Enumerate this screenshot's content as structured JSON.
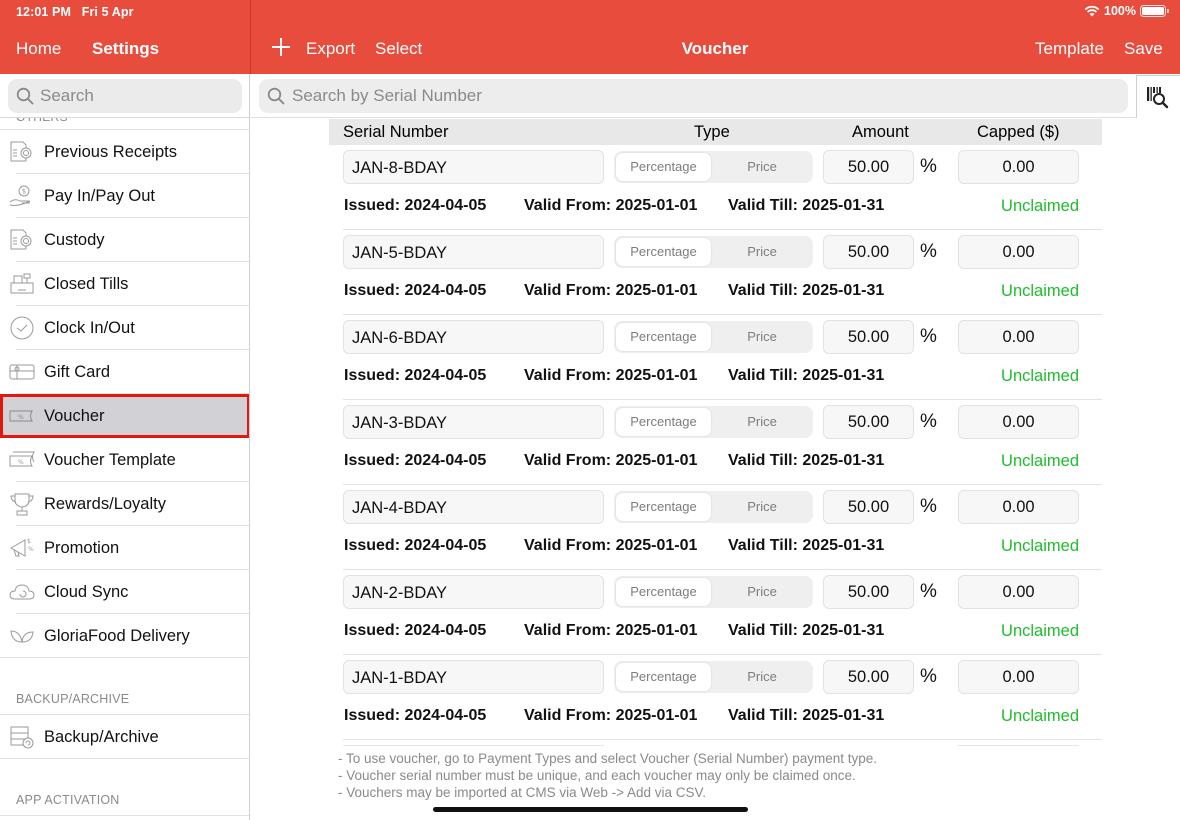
{
  "status_bar": {
    "time": "12:01 PM",
    "date": "Fri 5 Apr",
    "battery": "100%",
    "battery_level_percent": 100
  },
  "nav": {
    "home_label": "Home",
    "settings_label": "Settings",
    "add_icon": "plus-icon",
    "export_label": "Export",
    "select_label": "Select",
    "title": "Voucher",
    "template_label": "Template",
    "save_label": "Save"
  },
  "sidebar": {
    "search_placeholder": "Search",
    "cut_section_header": "OTHERS",
    "items": [
      {
        "label": "Previous Receipts",
        "icon": "receipt-icon"
      },
      {
        "label": "Pay In/Pay Out",
        "icon": "cash-hand-icon"
      },
      {
        "label": "Custody",
        "icon": "custody-icon"
      },
      {
        "label": "Closed Tills",
        "icon": "cash-register-icon"
      },
      {
        "label": "Clock In/Out",
        "icon": "clock-icon"
      },
      {
        "label": "Gift Card",
        "icon": "gift-card-icon"
      },
      {
        "label": "Voucher",
        "icon": "voucher-icon",
        "selected": true
      },
      {
        "label": "Voucher Template",
        "icon": "voucher-template-icon"
      },
      {
        "label": "Rewards/Loyalty",
        "icon": "trophy-icon"
      },
      {
        "label": "Promotion",
        "icon": "megaphone-icon"
      },
      {
        "label": "Cloud Sync",
        "icon": "cloud-sync-icon"
      },
      {
        "label": "GloriaFood Delivery",
        "icon": "leaf-icon"
      }
    ],
    "sections": [
      {
        "header": "BACKUP/ARCHIVE",
        "items": [
          {
            "label": "Backup/Archive",
            "icon": "server-backup-icon"
          }
        ]
      },
      {
        "header": "APP ACTIVATION",
        "items": []
      }
    ]
  },
  "main": {
    "search_placeholder": "Search by Serial Number",
    "scan_icon": "barcode-search-icon",
    "columns": [
      "Serial Number",
      "Type",
      "Amount",
      "Capped ($)"
    ],
    "type_options": [
      "Percentage",
      "Price"
    ],
    "amount_unit": "%",
    "issued_prefix": "Issued: ",
    "valid_from_prefix": "Valid From: ",
    "valid_till_prefix": "Valid Till: ",
    "vouchers": [
      {
        "serial": "JAN-8-BDAY",
        "type": "Percentage",
        "amount": "50.00",
        "capped": "0.00",
        "issued": "2024-04-05",
        "valid_from": "2025-01-01",
        "valid_till": "2025-01-31",
        "status": "Unclaimed"
      },
      {
        "serial": "JAN-5-BDAY",
        "type": "Percentage",
        "amount": "50.00",
        "capped": "0.00",
        "issued": "2024-04-05",
        "valid_from": "2025-01-01",
        "valid_till": "2025-01-31",
        "status": "Unclaimed"
      },
      {
        "serial": "JAN-6-BDAY",
        "type": "Percentage",
        "amount": "50.00",
        "capped": "0.00",
        "issued": "2024-04-05",
        "valid_from": "2025-01-01",
        "valid_till": "2025-01-31",
        "status": "Unclaimed"
      },
      {
        "serial": "JAN-3-BDAY",
        "type": "Percentage",
        "amount": "50.00",
        "capped": "0.00",
        "issued": "2024-04-05",
        "valid_from": "2025-01-01",
        "valid_till": "2025-01-31",
        "status": "Unclaimed"
      },
      {
        "serial": "JAN-4-BDAY",
        "type": "Percentage",
        "amount": "50.00",
        "capped": "0.00",
        "issued": "2024-04-05",
        "valid_from": "2025-01-01",
        "valid_till": "2025-01-31",
        "status": "Unclaimed"
      },
      {
        "serial": "JAN-2-BDAY",
        "type": "Percentage",
        "amount": "50.00",
        "capped": "0.00",
        "issued": "2024-04-05",
        "valid_from": "2025-01-01",
        "valid_till": "2025-01-31",
        "status": "Unclaimed"
      },
      {
        "serial": "JAN-1-BDAY",
        "type": "Percentage",
        "amount": "50.00",
        "capped": "0.00",
        "issued": "2024-04-05",
        "valid_from": "2025-01-01",
        "valid_till": "2025-01-31",
        "status": "Unclaimed"
      }
    ],
    "notes": [
      "- To use voucher, go to Payment Types and select Voucher (Serial Number) payment type.",
      "- Voucher serial number must be unique, and each voucher may only be claimed once.",
      "- Vouchers may be imported at CMS via Web -> Add via CSV."
    ]
  },
  "colors": {
    "brand_red": "#e84c3d",
    "selection_outline": "#e2180e",
    "selected_bg": "#d1d1d6",
    "status_unclaimed": "#1ebd2b"
  }
}
